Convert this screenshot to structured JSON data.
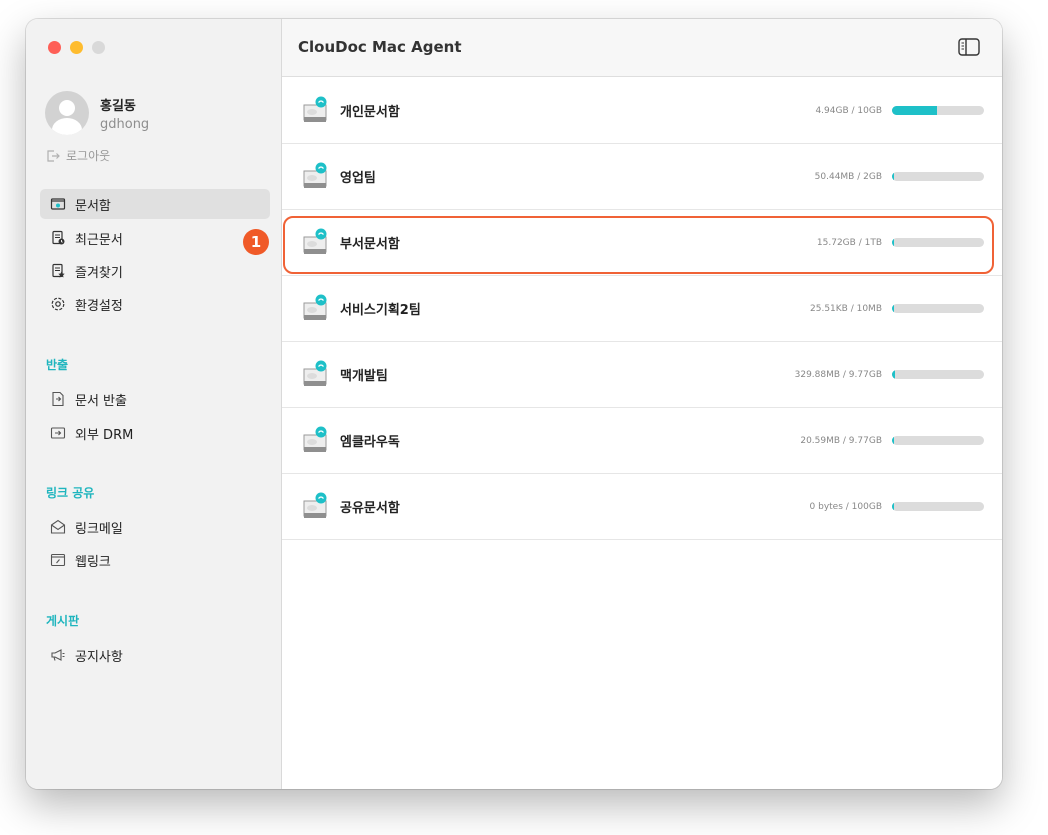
{
  "window": {
    "title": "ClouDoc Mac Agent"
  },
  "user": {
    "name": "홍길동",
    "id": "gdhong",
    "logout_label": "로그아웃"
  },
  "nav": {
    "main": [
      {
        "label": "문서함",
        "icon": "folder-icon",
        "active": true
      },
      {
        "label": "최근문서",
        "icon": "recent-doc-icon"
      },
      {
        "label": "즐겨찾기",
        "icon": "favorite-doc-icon"
      },
      {
        "label": "환경설정",
        "icon": "gear-icon"
      }
    ],
    "export_title": "반출",
    "export": [
      {
        "label": "문서 반출",
        "icon": "doc-export-icon"
      },
      {
        "label": "외부 DRM",
        "icon": "external-drm-icon"
      }
    ],
    "link_title": "링크 공유",
    "link": [
      {
        "label": "링크메일",
        "icon": "link-mail-icon"
      },
      {
        "label": "웹링크",
        "icon": "web-link-icon"
      }
    ],
    "board_title": "게시판",
    "board": [
      {
        "label": "공지사항",
        "icon": "megaphone-icon"
      }
    ]
  },
  "annotation": {
    "badge": "1"
  },
  "drives": [
    {
      "name": "개인문서함",
      "usage": "4.94GB / 10GB",
      "fill": 0.494
    },
    {
      "name": "영업팀",
      "usage": "50.44MB / 2GB",
      "fill": 0.025
    },
    {
      "name": "부서문서함",
      "usage": "15.72GB / 1TB",
      "fill": 0.015
    },
    {
      "name": "서비스기획2팀",
      "usage": "25.51KB / 10MB",
      "fill": 0.003
    },
    {
      "name": "맥개발팀",
      "usage": "329.88MB / 9.77GB",
      "fill": 0.034
    },
    {
      "name": "엠클라우독",
      "usage": "20.59MB / 9.77GB",
      "fill": 0.002
    },
    {
      "name": "공유문서함",
      "usage": "0 bytes / 100GB",
      "fill": 0
    }
  ],
  "colors": {
    "accent": "#1ec0c8",
    "section": "#1fb5be",
    "highlight": "#f06236"
  }
}
